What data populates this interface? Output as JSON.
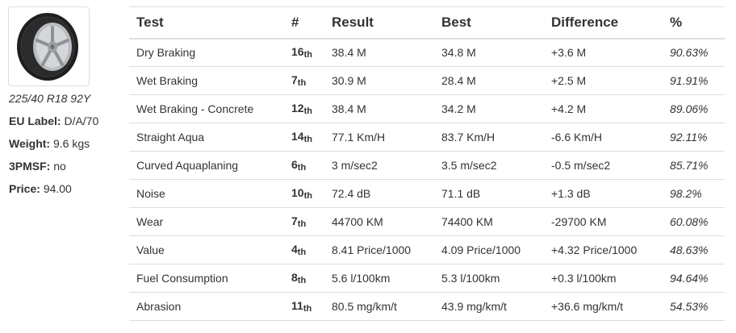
{
  "tyre": {
    "size": "225/40 R18 92Y",
    "specs": [
      {
        "label": "EU Label:",
        "value": "D/A/70"
      },
      {
        "label": "Weight:",
        "value": "9.6 kgs"
      },
      {
        "label": "3PMSF:",
        "value": "no"
      },
      {
        "label": "Price:",
        "value": "94.00"
      }
    ]
  },
  "table": {
    "headers": [
      "Test",
      "#",
      "Result",
      "Best",
      "Difference",
      "%"
    ],
    "rows": [
      {
        "test": "Dry Braking",
        "rank": "16",
        "suffix": "th",
        "result": "38.4 M",
        "best": "34.8 M",
        "diff": "+3.6 M",
        "pct": "90.63%"
      },
      {
        "test": "Wet Braking",
        "rank": "7",
        "suffix": "th",
        "result": "30.9 M",
        "best": "28.4 M",
        "diff": "+2.5 M",
        "pct": "91.91%"
      },
      {
        "test": "Wet Braking - Concrete",
        "rank": "12",
        "suffix": "th",
        "result": "38.4 M",
        "best": "34.2 M",
        "diff": "+4.2 M",
        "pct": "89.06%"
      },
      {
        "test": "Straight Aqua",
        "rank": "14",
        "suffix": "th",
        "result": "77.1 Km/H",
        "best": "83.7 Km/H",
        "diff": "-6.6 Km/H",
        "pct": "92.11%"
      },
      {
        "test": "Curved Aquaplaning",
        "rank": "6",
        "suffix": "th",
        "result": "3 m/sec2",
        "best": "3.5 m/sec2",
        "diff": "-0.5 m/sec2",
        "pct": "85.71%"
      },
      {
        "test": "Noise",
        "rank": "10",
        "suffix": "th",
        "result": "72.4 dB",
        "best": "71.1 dB",
        "diff": "+1.3 dB",
        "pct": "98.2%"
      },
      {
        "test": "Wear",
        "rank": "7",
        "suffix": "th",
        "result": "44700 KM",
        "best": "74400 KM",
        "diff": "-29700 KM",
        "pct": "60.08%"
      },
      {
        "test": "Value",
        "rank": "4",
        "suffix": "th",
        "result": "8.41 Price/1000",
        "best": "4.09 Price/1000",
        "diff": "+4.32 Price/1000",
        "pct": "48.63%"
      },
      {
        "test": "Fuel Consumption",
        "rank": "8",
        "suffix": "th",
        "result": "5.6 l/100km",
        "best": "5.3 l/100km",
        "diff": "+0.3 l/100km",
        "pct": "94.64%"
      },
      {
        "test": "Abrasion",
        "rank": "11",
        "suffix": "th",
        "result": "80.5 mg/km/t",
        "best": "43.9 mg/km/t",
        "diff": "+36.6 mg/km/t",
        "pct": "54.53%"
      }
    ]
  }
}
